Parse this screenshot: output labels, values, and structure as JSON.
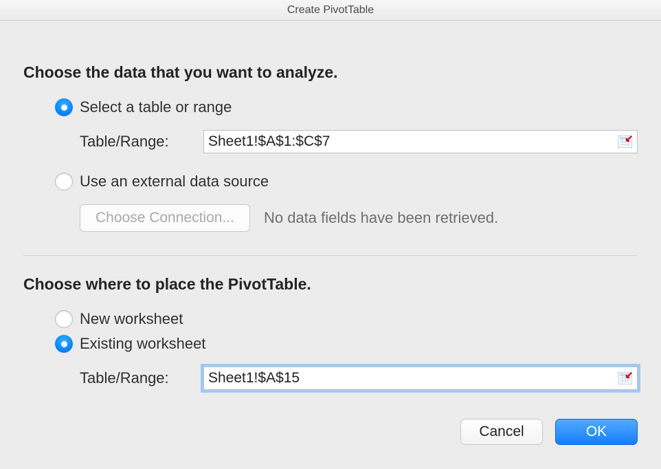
{
  "window": {
    "title": "Create PivotTable"
  },
  "section1": {
    "title": "Choose the data that you want to analyze.",
    "option1": {
      "label": "Select a table or range",
      "selected": true
    },
    "field1_label": "Table/Range:",
    "field1_value": "Sheet1!$A$1:$C$7",
    "option2": {
      "label": "Use an external data source",
      "selected": false
    },
    "choose_connection_label": "Choose Connection...",
    "connection_status": "No data fields have been retrieved."
  },
  "section2": {
    "title": "Choose where to place the PivotTable.",
    "optionA": {
      "label": "New worksheet",
      "selected": false
    },
    "optionB": {
      "label": "Existing worksheet",
      "selected": true
    },
    "field2_label": "Table/Range:",
    "field2_value": "Sheet1!$A$15"
  },
  "buttons": {
    "cancel": "Cancel",
    "ok": "OK"
  }
}
